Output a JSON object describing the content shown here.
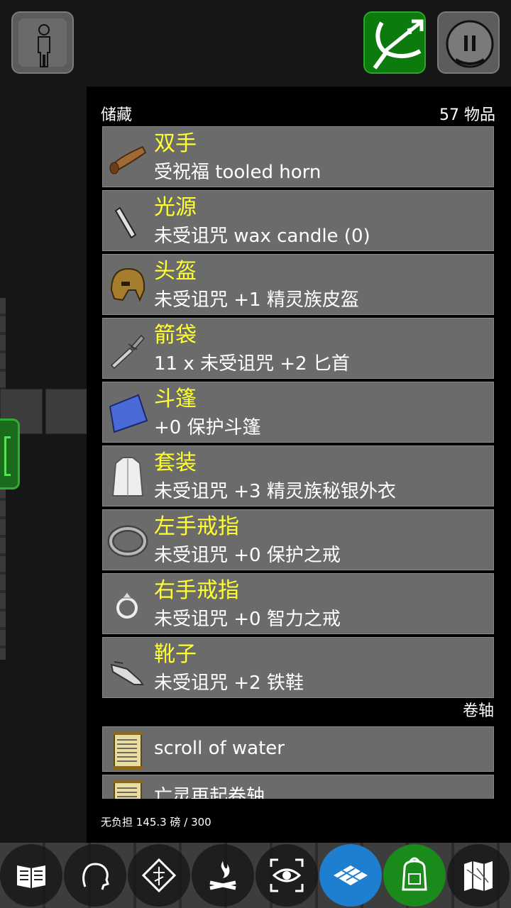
{
  "header": {
    "title": "储藏",
    "count": "57 物品"
  },
  "equipped": [
    {
      "slot": "双手",
      "desc": "受祝福 tooled horn",
      "icon": "horn-icon"
    },
    {
      "slot": "光源",
      "desc": "未受诅咒 wax candle (0)",
      "icon": "candle-icon"
    },
    {
      "slot": "头盔",
      "desc": "未受诅咒 +1 精灵族皮盔",
      "icon": "helmet-icon"
    },
    {
      "slot": "箭袋",
      "desc": "11 x 未受诅咒 +2 匕首",
      "icon": "dagger-icon"
    },
    {
      "slot": "斗篷",
      "desc": "+0 保护斗篷",
      "icon": "cloak-icon"
    },
    {
      "slot": "套装",
      "desc": "未受诅咒 +3 精灵族秘银外衣",
      "icon": "mithril-coat-icon"
    },
    {
      "slot": "左手戒指",
      "desc": "未受诅咒 +0 保护之戒",
      "icon": "ring-icon"
    },
    {
      "slot": "右手戒指",
      "desc": "未受诅咒 +0 智力之戒",
      "icon": "ring-gem-icon"
    },
    {
      "slot": "靴子",
      "desc": "未受诅咒 +2 铁鞋",
      "icon": "boots-icon"
    }
  ],
  "scrolls_section": "卷轴",
  "scrolls": [
    {
      "desc": "scroll of water",
      "icon": "scroll-icon"
    },
    {
      "desc": "亡灵再起卷轴",
      "icon": "scroll-icon"
    }
  ],
  "footer": "无负担 145.3 磅 / 300",
  "toolbar": [
    "spellbook-icon",
    "head-profile-icon",
    "sigil-icon",
    "campfire-icon",
    "search-eye-icon",
    "map-tiles-icon",
    "backpack-icon",
    "dungeon-map-icon"
  ],
  "colors": {
    "slot_text": "#ffff30",
    "item_bg": "#6b6b6b",
    "active_blue": "#1e7fd0",
    "active_green": "#1a8a1a"
  }
}
